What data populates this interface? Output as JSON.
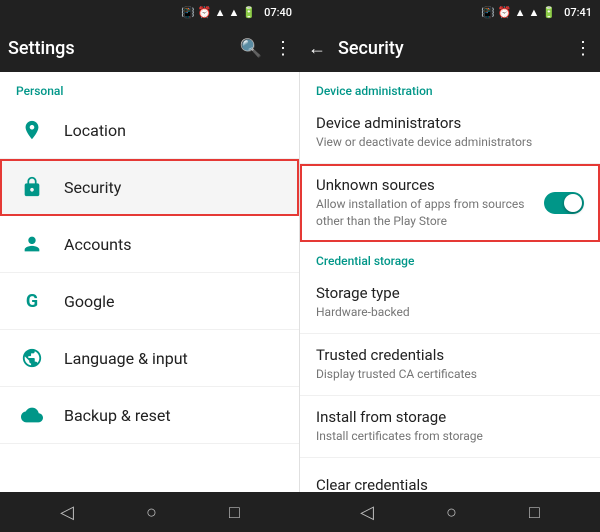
{
  "statusBar": {
    "left": {
      "time": "07:40"
    },
    "right": {
      "time": "07:41"
    }
  },
  "leftToolbar": {
    "title": "Settings",
    "searchIcon": "🔍",
    "moreIcon": "⋮"
  },
  "rightToolbar": {
    "title": "Security",
    "backIcon": "←",
    "moreIcon": "⋮"
  },
  "leftPanel": {
    "sectionLabel": "Personal",
    "items": [
      {
        "icon": "📍",
        "label": "Location"
      },
      {
        "icon": "🔒",
        "label": "Security",
        "active": true
      },
      {
        "icon": "👤",
        "label": "Accounts"
      },
      {
        "icon": "G",
        "label": "Google"
      },
      {
        "icon": "🌐",
        "label": "Language & input"
      },
      {
        "icon": "☁",
        "label": "Backup & reset"
      }
    ]
  },
  "rightPanel": {
    "sections": [
      {
        "sectionLabel": "Device administration",
        "items": [
          {
            "title": "Device administrators",
            "subtitle": "View or deactivate device administrators",
            "toggle": false,
            "highlighted": false
          },
          {
            "title": "Unknown sources",
            "subtitle": "Allow installation of apps from sources other than the Play Store",
            "toggle": true,
            "toggleOn": true,
            "highlighted": true
          }
        ]
      },
      {
        "sectionLabel": "Credential storage",
        "items": [
          {
            "title": "Storage type",
            "subtitle": "Hardware-backed",
            "toggle": false,
            "highlighted": false
          },
          {
            "title": "Trusted credentials",
            "subtitle": "Display trusted CA certificates",
            "toggle": false,
            "highlighted": false
          },
          {
            "title": "Install from storage",
            "subtitle": "Install certificates from storage",
            "toggle": false,
            "highlighted": false
          },
          {
            "title": "Clear credentials",
            "subtitle": "",
            "toggle": false,
            "highlighted": false
          }
        ]
      }
    ]
  },
  "leftNav": {
    "back": "◁",
    "home": "○",
    "recent": "□"
  },
  "rightNav": {
    "back": "◁",
    "home": "○",
    "recent": "□"
  }
}
